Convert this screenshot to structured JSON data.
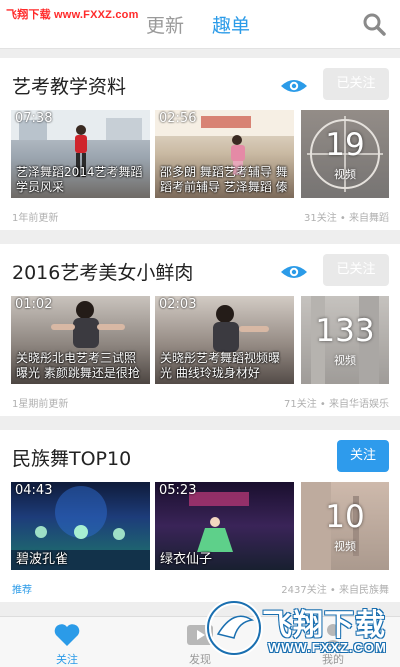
{
  "watermark_top": "飞翔下载 www.FXXZ.com",
  "header": {
    "tabs": [
      "更新",
      "趣单"
    ],
    "active_tab": 1,
    "search_icon": "search-icon"
  },
  "colors": {
    "accent": "#2b9be8",
    "follow": "#2e9bec",
    "followed": "#e9e9e9"
  },
  "cards": [
    {
      "title": "艺考教学资料",
      "follow_label": "已关注",
      "videos": [
        {
          "duration": "07:38",
          "caption": "艺泽舞蹈2014艺考舞蹈学员风采"
        },
        {
          "duration": "02:56",
          "caption": "邵多朗 舞蹈艺考辅导 舞蹈考前辅导 艺泽舞蹈 傣"
        }
      ],
      "more_count": "19",
      "more_label": "视频",
      "updated": "1年前更新",
      "stats": "31关注 • 来自舞蹈"
    },
    {
      "title": "2016艺考美女小鲜肉",
      "follow_label": "已关注",
      "videos": [
        {
          "duration": "01:02",
          "caption": "关晓彤北电艺考三试照曝光 素颜跳舞还是很抢"
        },
        {
          "duration": "02:03",
          "caption": "关晓彤艺考舞蹈视频曝光 曲线玲珑身材好"
        }
      ],
      "more_count": "133",
      "more_label": "视频",
      "updated": "1星期前更新",
      "stats": "71关注 • 来自华语娱乐"
    },
    {
      "title": "民族舞TOP10",
      "follow_label": "关注",
      "videos": [
        {
          "duration": "04:43",
          "caption": "碧波孔雀"
        },
        {
          "duration": "05:23",
          "caption": "绿衣仙子"
        }
      ],
      "more_count": "10",
      "more_label": "视频",
      "updated": "推荐",
      "stats": "2437关注 • 来自民族舞"
    }
  ],
  "bottom_nav": [
    {
      "label": "关注",
      "icon": "heart-icon"
    },
    {
      "label": "发现",
      "icon": "play-icon"
    },
    {
      "label": "我的",
      "icon": "person-icon"
    }
  ],
  "watermark_logo": {
    "title": "飞翔下载",
    "url": "WWW.FXXZ.COM"
  }
}
